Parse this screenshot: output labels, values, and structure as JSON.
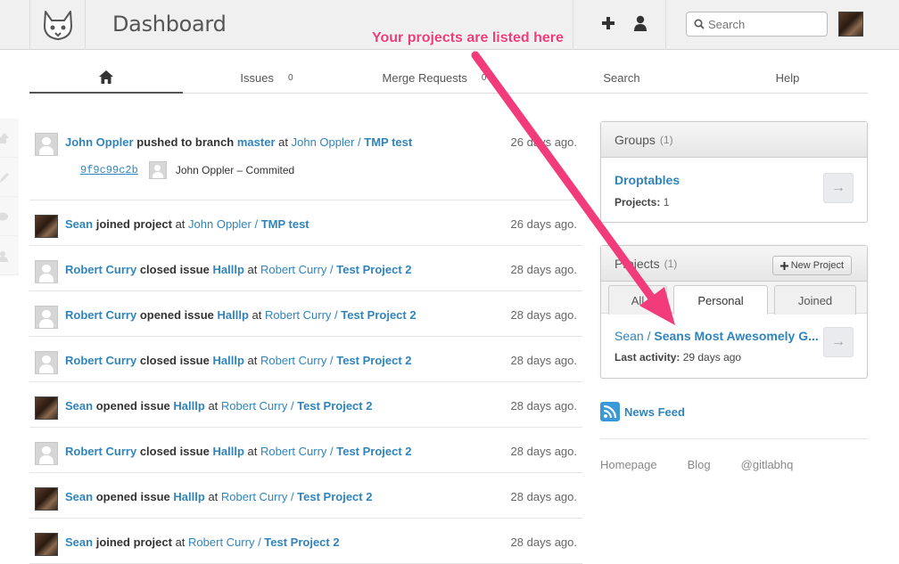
{
  "header": {
    "title": "Dashboard",
    "search_placeholder": "Search",
    "colors": {
      "link": "#3084bb",
      "annotation": "#f23b7a"
    }
  },
  "nav": {
    "tabs": [
      {
        "label": "",
        "icon": "home-icon"
      },
      {
        "label": "Issues",
        "count": "0"
      },
      {
        "label": "Merge Requests",
        "count": "0"
      },
      {
        "label": "Search"
      },
      {
        "label": "Help"
      }
    ]
  },
  "events": [
    {
      "author": "John Oppler",
      "action": "pushed to branch",
      "target": "master",
      "at": "at",
      "namespace": "John Oppler",
      "project": "TMP test",
      "time": "26 days ago.",
      "commit": {
        "sha": "9f9c99c2b",
        "text": "John Oppler – Commited"
      }
    },
    {
      "author": "Sean",
      "action": "joined project",
      "at": "at",
      "namespace": "John Oppler",
      "project": "TMP test",
      "time": "26 days ago."
    },
    {
      "author": "Robert Curry",
      "action": "closed issue",
      "target": "Halllp",
      "at": "at",
      "namespace": "Robert Curry",
      "project": "Test Project 2",
      "time": "28 days ago."
    },
    {
      "author": "Robert Curry",
      "action": "opened issue",
      "target": "Halllp",
      "at": "at",
      "namespace": "Robert Curry",
      "project": "Test Project 2",
      "time": "28 days ago."
    },
    {
      "author": "Robert Curry",
      "action": "closed issue",
      "target": "Halllp",
      "at": "at",
      "namespace": "Robert Curry",
      "project": "Test Project 2",
      "time": "28 days ago."
    },
    {
      "author": "Sean",
      "action": "opened issue",
      "target": "Halllp",
      "at": "at",
      "namespace": "Robert Curry",
      "project": "Test Project 2",
      "time": "28 days ago."
    },
    {
      "author": "Robert Curry",
      "action": "closed issue",
      "target": "Halllp",
      "at": "at",
      "namespace": "Robert Curry",
      "project": "Test Project 2",
      "time": "28 days ago."
    },
    {
      "author": "Sean",
      "action": "opened issue",
      "target": "Halllp",
      "at": "at",
      "namespace": "Robert Curry",
      "project": "Test Project 2",
      "time": "28 days ago."
    },
    {
      "author": "Sean",
      "action": "joined project",
      "at": "at",
      "namespace": "Robert Curry",
      "project": "Test Project 2",
      "time": "28 days ago."
    }
  ],
  "groups": {
    "title": "Groups",
    "count": "(1)",
    "item": {
      "name": "Droptables",
      "meta_label": "Projects:",
      "meta_value": "1"
    }
  },
  "projects": {
    "title": "Projects",
    "count": "(1)",
    "new_button": "New Project",
    "tabs": [
      "All",
      "Personal",
      "Joined"
    ],
    "item": {
      "namespace": "Sean / ",
      "name": "Seans Most Awesomely G...",
      "meta_label": "Last activity:",
      "meta_value": "29 days ago"
    }
  },
  "news_feed": "News Feed",
  "footer": [
    "Homepage",
    "Blog",
    "@gitlabhq"
  ],
  "annotation": "Your projects are listed here"
}
